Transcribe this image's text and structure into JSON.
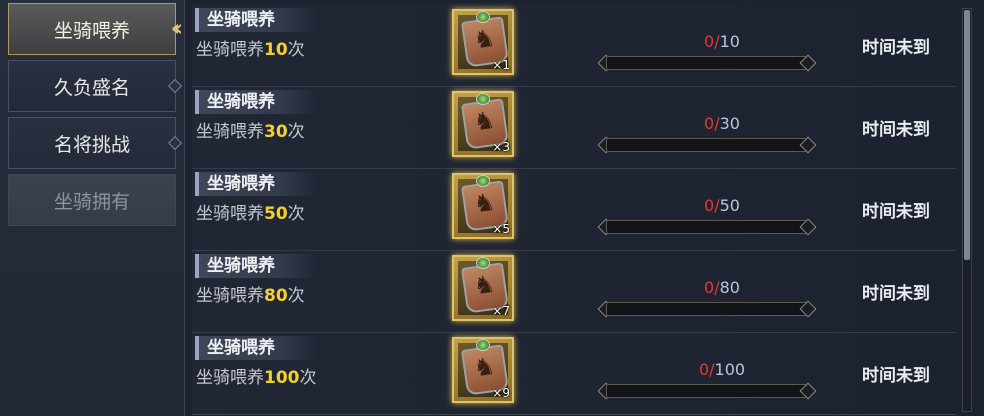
{
  "sidebar": {
    "tabs": [
      {
        "label": "坐骑喂养",
        "state": "active"
      },
      {
        "label": "久负盛名",
        "state": "normal"
      },
      {
        "label": "名将挑战",
        "state": "normal"
      },
      {
        "label": "坐骑拥有",
        "state": "disabled"
      }
    ]
  },
  "rows": [
    {
      "title": "坐骑喂养",
      "desc_prefix": "坐骑喂养",
      "desc_num": "10",
      "desc_suffix": "次",
      "item_qty": "×1",
      "progress_current": "0",
      "progress_sep": "/",
      "progress_total": "10",
      "progress_fraction": 0,
      "status": "时间未到",
      "item_icon": "horse-token-icon"
    },
    {
      "title": "坐骑喂养",
      "desc_prefix": "坐骑喂养",
      "desc_num": "30",
      "desc_suffix": "次",
      "item_qty": "×3",
      "progress_current": "0",
      "progress_sep": "/",
      "progress_total": "30",
      "progress_fraction": 0,
      "status": "时间未到",
      "item_icon": "horse-token-icon"
    },
    {
      "title": "坐骑喂养",
      "desc_prefix": "坐骑喂养",
      "desc_num": "50",
      "desc_suffix": "次",
      "item_qty": "×5",
      "progress_current": "0",
      "progress_sep": "/",
      "progress_total": "50",
      "progress_fraction": 0,
      "status": "时间未到",
      "item_icon": "horse-token-icon"
    },
    {
      "title": "坐骑喂养",
      "desc_prefix": "坐骑喂养",
      "desc_num": "80",
      "desc_suffix": "次",
      "item_qty": "×7",
      "progress_current": "0",
      "progress_sep": "/",
      "progress_total": "80",
      "progress_fraction": 0,
      "status": "时间未到",
      "item_icon": "horse-token-icon"
    },
    {
      "title": "坐骑喂养",
      "desc_prefix": "坐骑喂养",
      "desc_num": "100",
      "desc_suffix": "次",
      "item_qty": "×9",
      "progress_current": "0",
      "progress_sep": "/",
      "progress_total": "100",
      "progress_fraction": 0,
      "status": "时间未到",
      "item_icon": "horse-token-icon"
    }
  ],
  "colors": {
    "accent_gold": "#e2c47a",
    "highlight_number": "#f3d02c",
    "progress_current": "#e03a32"
  }
}
